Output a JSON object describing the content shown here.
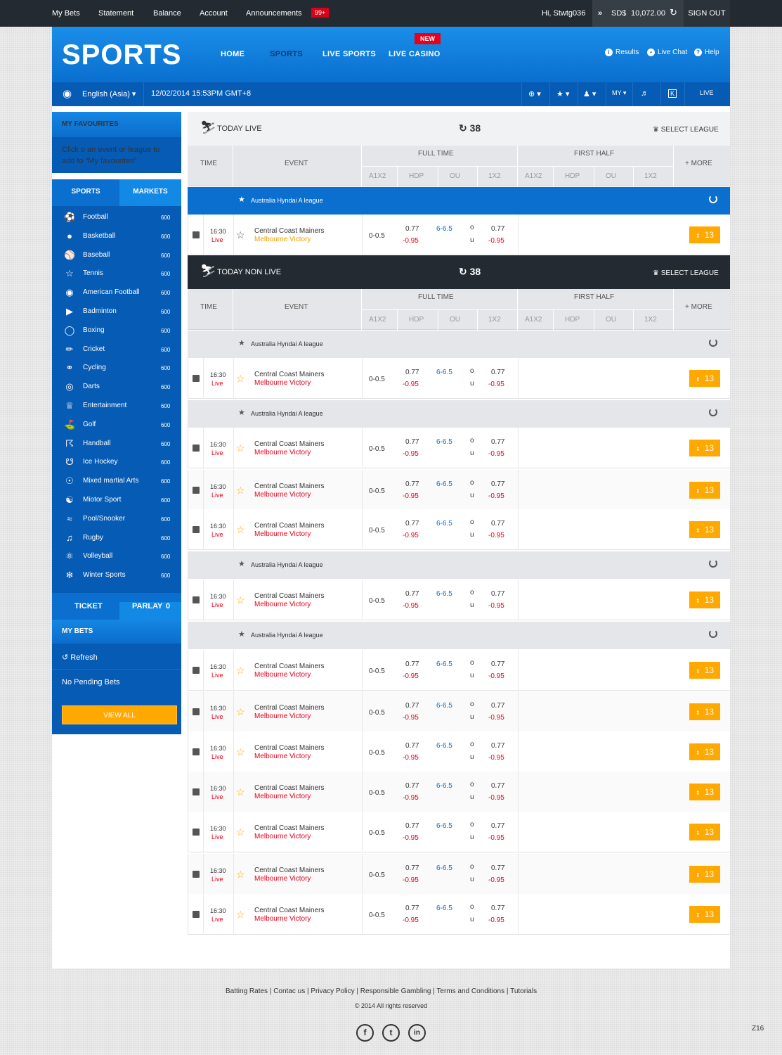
{
  "topbar": {
    "links": [
      "My Bets",
      "Statement",
      "Balance",
      "Account",
      "Announcements"
    ],
    "badge": "99+",
    "greeting": "Hi, Stwtg036",
    "currency": "SD$",
    "balance": "10,072.00",
    "signout": "SIGN OUT"
  },
  "header": {
    "logo": "SPORTS",
    "nav": [
      "HOME",
      "SPORTS",
      "LIVE SPORTS",
      "LIVE CASINO"
    ],
    "new_badge": "NEW",
    "links": [
      "Results",
      "Live Chat",
      "Help"
    ]
  },
  "subbar": {
    "language": "English (Asia)",
    "datetime": "12/02/2014 15:53PM GMT+8",
    "my": "MY",
    "live": "LIVE"
  },
  "sidebar": {
    "fav_title": "MY FAVOURITES",
    "fav_text": "Click o an event or league to add to “My favourites”",
    "tabs": [
      "SPORTS",
      "MARKETS"
    ],
    "sports": [
      {
        "name": "Football",
        "count": "600",
        "icon": "football-icon"
      },
      {
        "name": "Basketball",
        "count": "600",
        "icon": "basketball-icon"
      },
      {
        "name": "Baseball",
        "count": "600",
        "icon": "baseball-icon"
      },
      {
        "name": "Tennis",
        "count": "600",
        "icon": "tennis-icon"
      },
      {
        "name": "American Football",
        "count": "600",
        "icon": "american-football-icon"
      },
      {
        "name": "Badminton",
        "count": "600",
        "icon": "badminton-icon"
      },
      {
        "name": "Boxing",
        "count": "600",
        "icon": "boxing-icon"
      },
      {
        "name": "Cricket",
        "count": "600",
        "icon": "cricket-icon"
      },
      {
        "name": "Cycling",
        "count": "600",
        "icon": "cycling-icon"
      },
      {
        "name": "Darts",
        "count": "600",
        "icon": "darts-icon"
      },
      {
        "name": "Entertainment",
        "count": "600",
        "icon": "entertainment-icon"
      },
      {
        "name": "Golf",
        "count": "600",
        "icon": "golf-icon"
      },
      {
        "name": "Handball",
        "count": "600",
        "icon": "handball-icon"
      },
      {
        "name": "Ice Hockey",
        "count": "600",
        "icon": "ice-hockey-icon"
      },
      {
        "name": "Mixed martial Arts",
        "count": "600",
        "icon": "mma-icon"
      },
      {
        "name": "Miotor Sport",
        "count": "600",
        "icon": "motor-sport-icon"
      },
      {
        "name": "Pool/Snooker",
        "count": "600",
        "icon": "pool-icon"
      },
      {
        "name": "Rugby",
        "count": "600",
        "icon": "rugby-icon"
      },
      {
        "name": "Volleyball",
        "count": "600",
        "icon": "volleyball-icon"
      },
      {
        "name": "Winter Sports",
        "count": "600",
        "icon": "winter-sports-icon"
      }
    ],
    "ticket": "TICKET",
    "parlay": "PARLAY",
    "parlay_count": "0",
    "mybets": "MY BETS",
    "refresh": "Refresh",
    "no_pending": "No Pending Bets",
    "view_all": "VIEW ALL"
  },
  "table": {
    "col_time": "TIME",
    "col_event": "EVENT",
    "full_time": "FULL TIME",
    "first_half": "FIRST HALF",
    "more": "+ MORE",
    "subcols": [
      "A1X2",
      "HDP",
      "OU",
      "1X2",
      "A1X2",
      "HDP",
      "OU",
      "1X2"
    ],
    "live_title": "TODAY LIVE",
    "nonlive_title": "TODAY NON LIVE",
    "count": "38",
    "select_league": "SELECT LEAGUE",
    "league": "Australia Hyndai A league",
    "row": {
      "time": "16:30",
      "live": "Live",
      "home": "Central Coast Mainers",
      "away": "Melbourne Victory",
      "hdp": "0-0.5",
      "odd1": "0.77",
      "odd2": "-0.95",
      "hdp_line": "6-6.5",
      "o": "o",
      "u": "u",
      "odd3": "0.77",
      "odd4": "-0.95",
      "more_count": "13"
    }
  },
  "footer": {
    "links": [
      "Batting Rates",
      "Contac us",
      "Privacy Policy",
      "Responsible Gambling",
      "Terms and Conditions",
      "Tutorials"
    ],
    "copyright": "© 2014 All rights reserved",
    "social": [
      "f",
      "t",
      "in"
    ],
    "page_code": "Z16"
  }
}
